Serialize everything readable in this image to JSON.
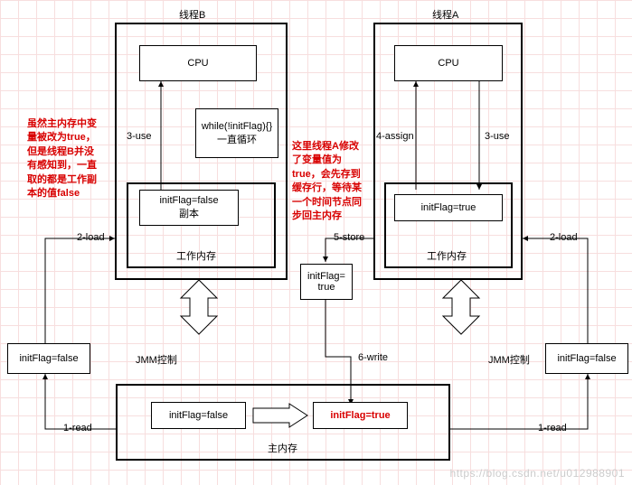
{
  "threadB": {
    "title": "线程B",
    "cpu": "CPU",
    "loop": "while(!initFlag){}\n一直循环",
    "copy": "initFlag=false\n副本",
    "workmem": "工作内存",
    "note": "虽然主内存中变\n量被改为true，\n但是线程B并没\n有感知到，一直\n取的都是工作副\n本的值false"
  },
  "threadA": {
    "title": "线程A",
    "cpu": "CPU",
    "assign": "initFlag=true",
    "workmem": "工作内存",
    "note": "这里线程A修改\n了变量值为\ntrue，会先存到\n缓存行，等待某\n一个时间节点同\n步回主内存"
  },
  "buffer": {
    "storebox": "initFlag=\ntrue"
  },
  "mainmem": {
    "title": "主内存",
    "before": "initFlag=false",
    "after": "initFlag=true"
  },
  "side": {
    "left": "initFlag=false",
    "right": "initFlag=false"
  },
  "edges": {
    "use_b": "3-use",
    "load_b": "2-load",
    "read_b": "1-read",
    "jmm_b": "JMM控制",
    "assign_a": "4-assign",
    "use_a": "3-use",
    "store_a": "5-store",
    "write_a": "6-write",
    "load_a": "2-load",
    "read_a": "1-read",
    "jmm_a": "JMM控制"
  },
  "watermark": "https://blog.csdn.net/u012988901"
}
